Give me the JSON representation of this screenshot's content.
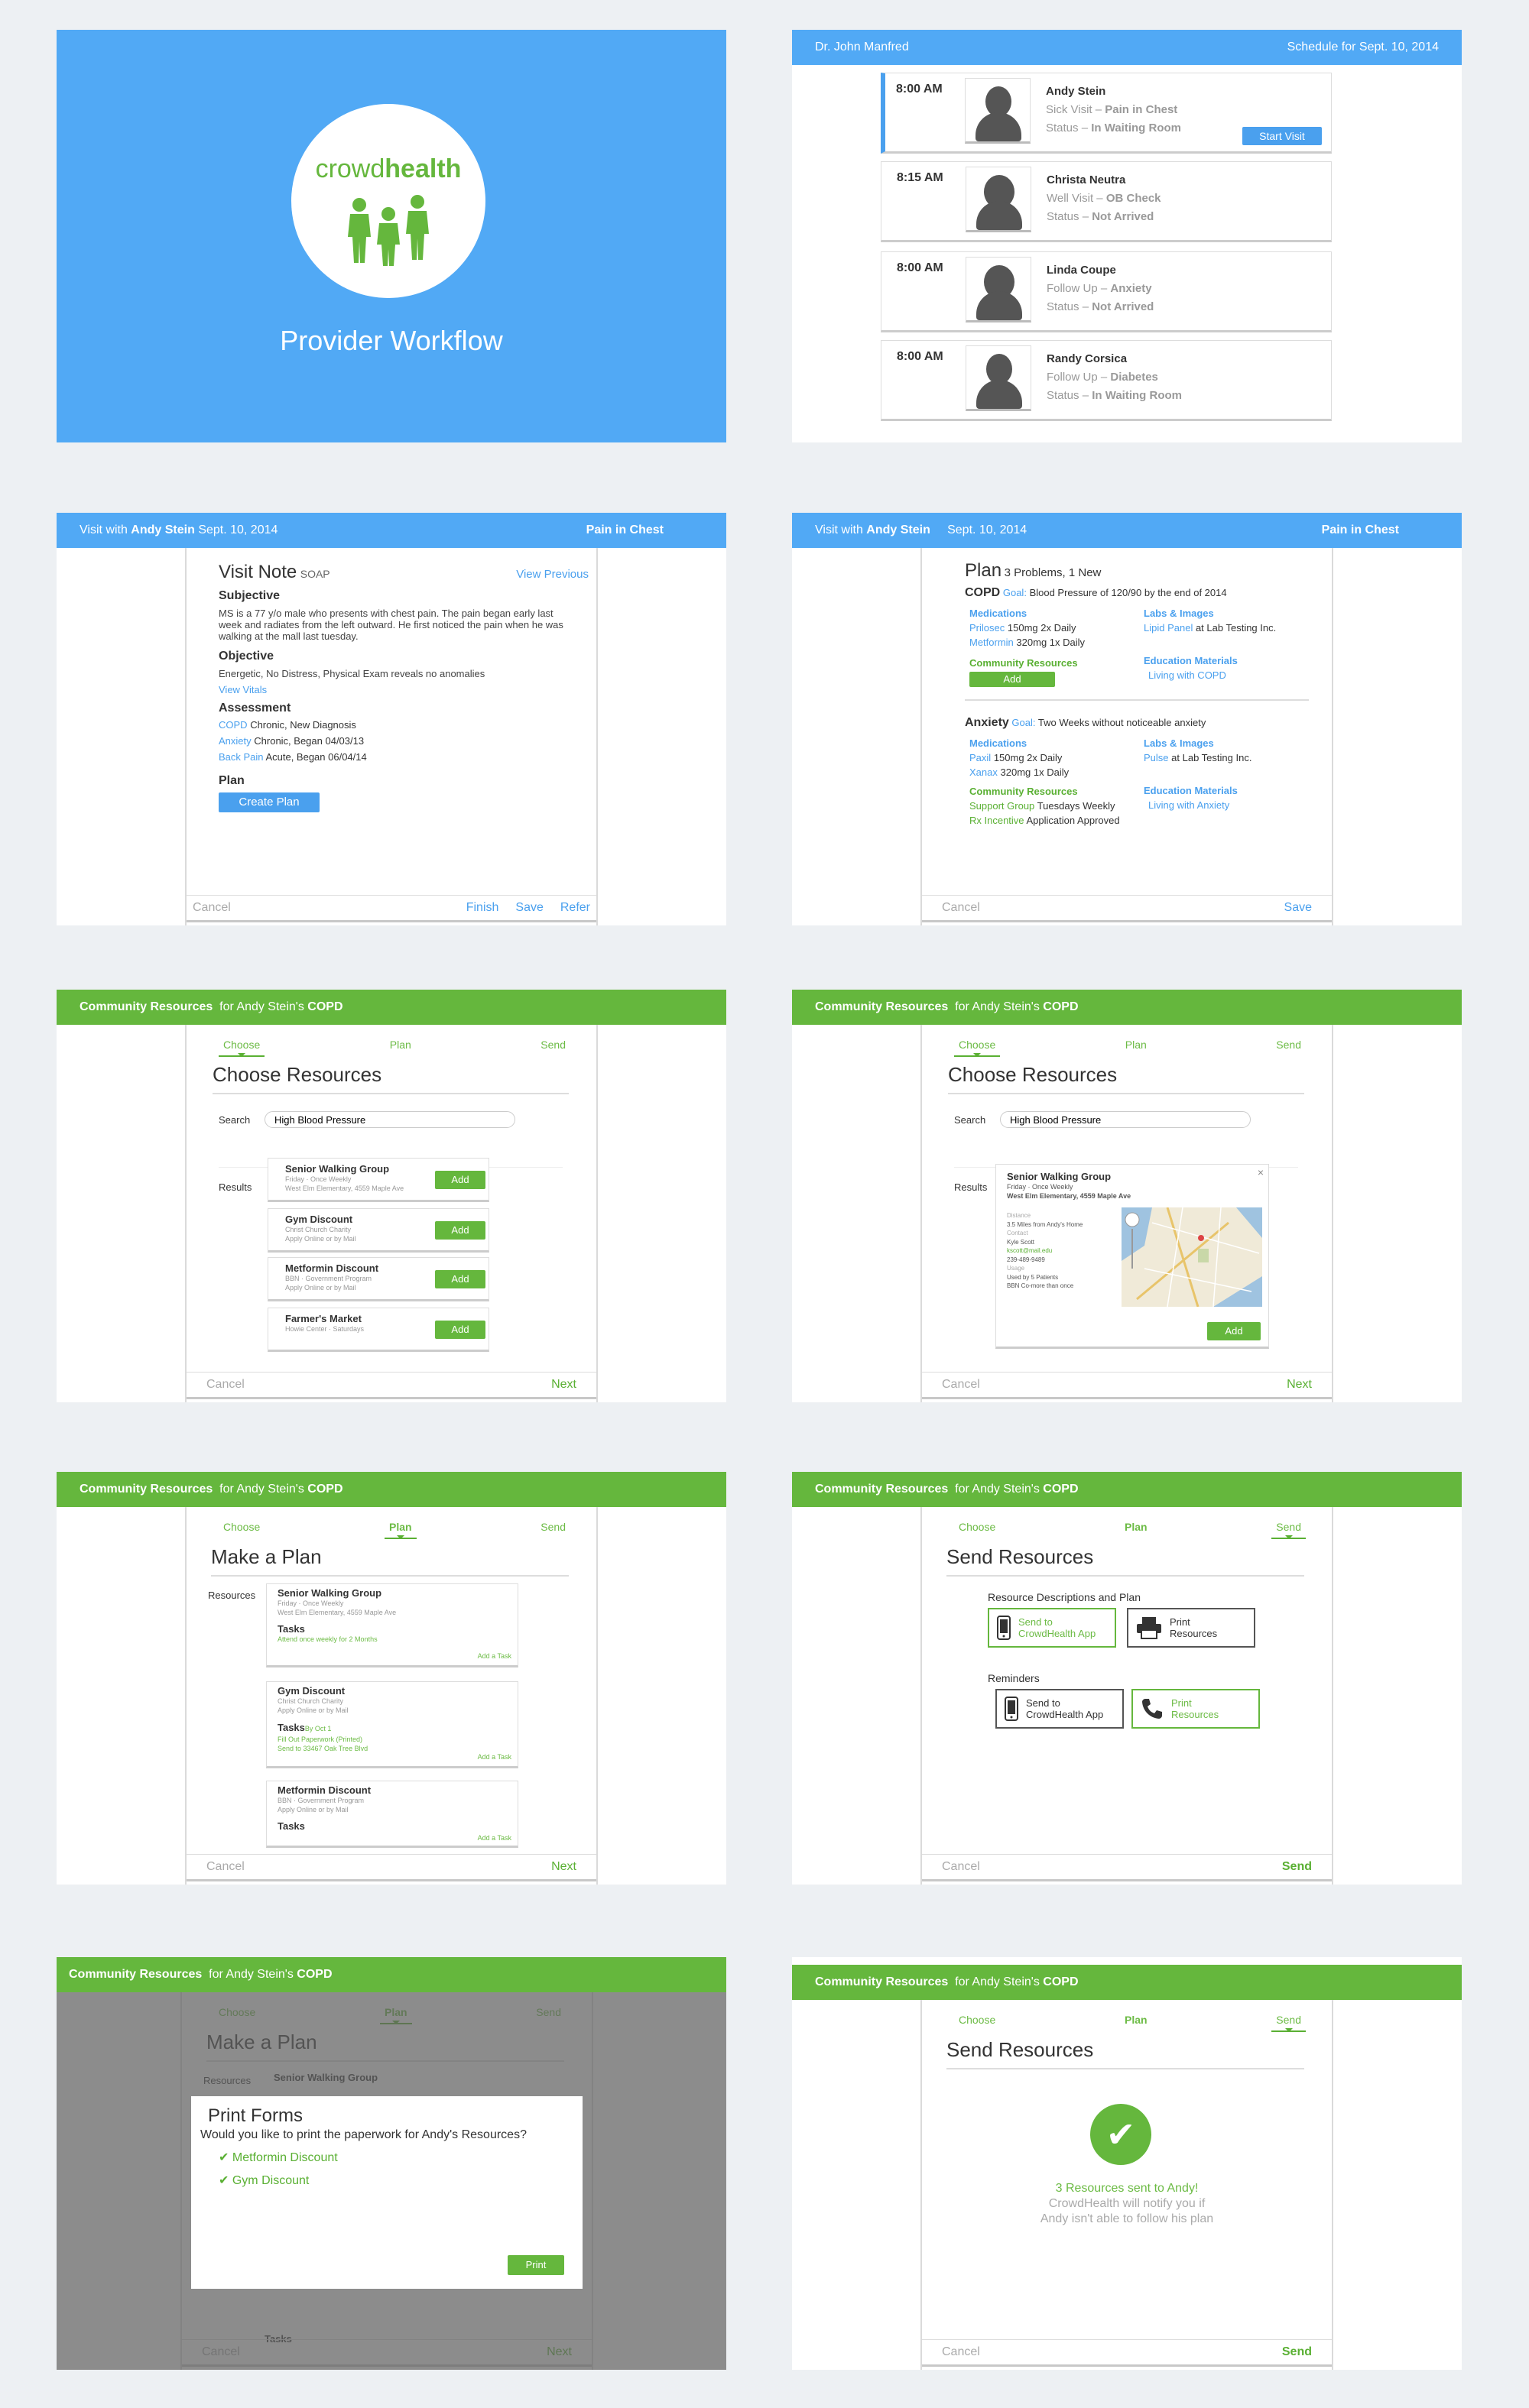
{
  "colors": {
    "blue": "#51a9f5",
    "green": "#65b73d",
    "bg": "#edf0f3"
  },
  "intro": {
    "brand_prefix": "crowd",
    "brand_suffix": "health",
    "subtitle": "Provider Workflow"
  },
  "schedule": {
    "doctor": "Dr. John Manfred",
    "date": "Schedule for Sept. 10, 2014",
    "start_label": "Start Visit",
    "items": [
      {
        "time": "8:00 AM",
        "name": "Andy Stein",
        "type": "Sick Visit",
        "reason": "Pain in Chest",
        "status_label": "Status",
        "status": "In Waiting Room"
      },
      {
        "time": "8:15 AM",
        "name": "Christa Neutra",
        "type": "Well Visit",
        "reason": "OB Check",
        "status_label": "Status",
        "status": "Not Arrived"
      },
      {
        "time": "8:00 AM",
        "name": "Linda Coupe",
        "type": "Follow Up",
        "reason": "Anxiety",
        "status_label": "Status",
        "status": "Not Arrived"
      },
      {
        "time": "8:00 AM",
        "name": "Randy Corsica",
        "type": "Follow Up",
        "reason": "Diabetes",
        "status_label": "Status",
        "status": "In Waiting Room"
      }
    ]
  },
  "visit": {
    "prefix": "Visit with",
    "patient": "Andy Stein",
    "date": "Sept. 10, 2014",
    "reason": "Pain in Chest"
  },
  "note": {
    "title": "Visit Note",
    "soap": "SOAP",
    "view_previous": "View Previous",
    "subjective_h": "Subjective",
    "subjective": "MS is a 77 y/o male who presents with chest pain. The pain began early last week and radiates from the left outward. He first noticed the pain when he was walking at the mall last tuesday.",
    "objective_h": "Objective",
    "objective": "Energetic, No Distress, Physical Exam reveals no anomalies",
    "view_vitals": "View Vitals",
    "assessment_h": "Assessment",
    "assessments": [
      {
        "name": "COPD",
        "detail": "Chronic, New Diagnosis"
      },
      {
        "name": "Anxiety",
        "detail": "Chronic, Began 04/03/13"
      },
      {
        "name": "Back Pain",
        "detail": "Acute, Began 06/04/14"
      }
    ],
    "plan_h": "Plan",
    "create_plan": "Create Plan",
    "cancel": "Cancel",
    "finish": "Finish",
    "save": "Save",
    "refer": "Refer"
  },
  "plan": {
    "title": "Plan",
    "count": "3 Problems, 1 New",
    "goal_label": "Goal:",
    "save": "Save",
    "cancel": "Cancel",
    "p1": {
      "name": "COPD",
      "goal": "Blood Pressure of 120/90 by the end of 2014",
      "med_h": "Medications",
      "meds": [
        {
          "link": "Prilosec",
          "text": "150mg 2x Daily"
        },
        {
          "link": "Metformin",
          "text": "320mg 1x Daily"
        }
      ],
      "labs_h": "Labs & Images",
      "labs": [
        {
          "link": "Lipid Panel",
          "text": "at Lab Testing Inc."
        }
      ],
      "cr_h": "Community Resources",
      "add": "Add",
      "edu_h": "Education Materials",
      "edu": "Living with COPD"
    },
    "p2": {
      "name": "Anxiety",
      "goal": "Two Weeks without noticeable anxiety",
      "med_h": "Medications",
      "meds": [
        {
          "link": "Paxil",
          "text": "150mg 2x Daily"
        },
        {
          "link": "Xanax",
          "text": "320mg 1x Daily"
        }
      ],
      "labs_h": "Labs & Images",
      "labs": [
        {
          "link": "Pulse",
          "text": "at Lab Testing Inc."
        }
      ],
      "cr_h": "Community Resources",
      "crs": [
        {
          "link": "Support Group",
          "text": "Tuesdays Weekly"
        },
        {
          "link": "Rx Incentive",
          "text": "Application Approved"
        }
      ],
      "edu_h": "Education Materials",
      "edu": "Living with Anxiety"
    }
  },
  "cr": {
    "title": "Community Resources",
    "for_text": "for Andy Stein's",
    "condition": "COPD",
    "steps": [
      "Choose",
      "Plan",
      "Send"
    ],
    "choose_title": "Choose Resources",
    "plan_title": "Make a Plan",
    "send_title": "Send Resources",
    "search_label": "Search",
    "search_value": "High Blood Pressure",
    "results_label": "Results",
    "add": "Add",
    "cancel": "Cancel",
    "next": "Next",
    "send": "Send",
    "results": [
      {
        "name": "Senior Walking Group",
        "l1": "Friday · Once Weekly",
        "l2": "West Elm Elementary, 4559 Maple Ave"
      },
      {
        "name": "Gym Discount",
        "l1": "Christ Church Charity",
        "l2": "Apply Online or by Mail"
      },
      {
        "name": "Metformin Discount",
        "l1": "BBN · Government Program",
        "l2": "Apply Online or by Mail"
      },
      {
        "name": "Farmer's Market",
        "l1": "Howie Center · Saturdays",
        "l2": ""
      }
    ],
    "detail": {
      "name": "Senior Walking Group",
      "l1": "Friday · Once Weekly",
      "l2": "West Elm Elementary, 4559 Maple Ave",
      "distance_h": "Distance",
      "distance": "3.5 Miles from Andy's Home",
      "contact_h": "Contact",
      "contact_name": "Kyle Scott",
      "contact_email": "kscott@mail.edu",
      "contact_phone": "239-489-9489",
      "usage_h": "Usage",
      "usage1": "Used by 5 Patients",
      "usage2": "BBN Co-more than once",
      "close": "×"
    },
    "resources_label": "Resources",
    "tasks_label": "Tasks",
    "add_task": "Add a Task",
    "by_oct": "By Oct 1",
    "plan_items": [
      {
        "name": "Senior Walking Group",
        "l1": "Friday · Once Weekly",
        "l2": "West Elm Elementary, 4559 Maple Ave",
        "task1": "Attend once weekly for 2 Months",
        "task2": ""
      },
      {
        "name": "Gym Discount",
        "l1": "Christ Church Charity",
        "l2": "Apply Online or by Mail",
        "task1": "Fill Out Paperwork (Printed)",
        "task2": "Send to 33467 Oak Tree Blvd"
      },
      {
        "name": "Metformin Discount",
        "l1": "BBN · Government Program",
        "l2": "Apply Online or by Mail",
        "task1": "",
        "task2": ""
      }
    ],
    "desc_label": "Resource Descriptions and Plan",
    "reminders_label": "Reminders",
    "opt_app": "Send to CrowdHealth App",
    "opt_print": "Print Resources",
    "print_title": "Print Forms",
    "print_q": "Would you like to print the paperwork for Andy's Resources?",
    "print_items": [
      "Metformin Discount",
      "Gym Discount"
    ],
    "print_btn": "Print",
    "success_line": "3 Resources sent to Andy!",
    "success_sub1": "CrowdHealth will notify you if",
    "success_sub2": "Andy isn't able to follow his plan"
  }
}
